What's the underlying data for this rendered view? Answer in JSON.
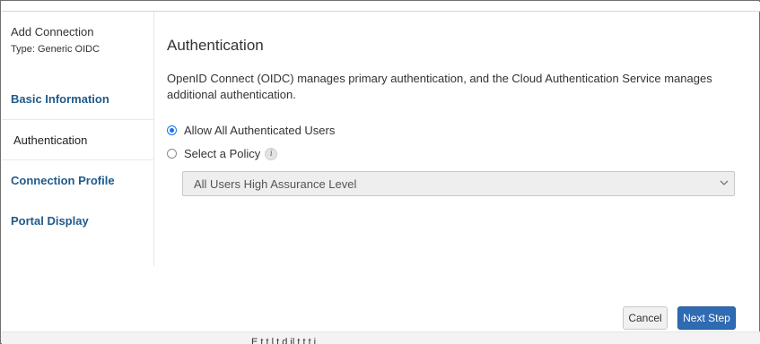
{
  "sidebar": {
    "title": "Add Connection",
    "type_label": "Type: Generic OIDC",
    "items": [
      {
        "label": "Basic Information",
        "active": false
      },
      {
        "label": "Authentication",
        "active": true
      },
      {
        "label": "Connection Profile",
        "active": false
      },
      {
        "label": "Portal Display",
        "active": false
      }
    ]
  },
  "main": {
    "heading": "Authentication",
    "description": "OpenID Connect (OIDC) manages primary authentication, and the Cloud Authentication Service manages additional authentication.",
    "options": [
      {
        "label": "Allow All Authenticated Users",
        "checked": true
      },
      {
        "label": "Select a Policy",
        "checked": false
      }
    ],
    "info_icon_glyph": "i",
    "policy_select": {
      "value": "All Users High Assurance Level"
    }
  },
  "footer": {
    "cancel_label": "Cancel",
    "next_label": "Next Step"
  },
  "bottom_text": "E t t    l t        d  il  t   t t     i",
  "colors": {
    "accent": "#2f6bb3",
    "nav_link": "#1f5a8c",
    "radio": "#1a73e8"
  }
}
